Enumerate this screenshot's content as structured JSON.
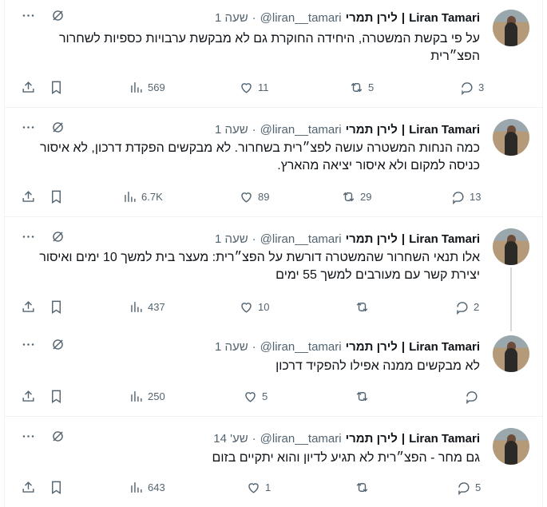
{
  "tweets": [
    {
      "name": "Liran Tamari",
      "hebrew_name": "לירן תמרי",
      "handle": "@liran__tamari",
      "time": "שעה 1",
      "text": "על פי בקשת המשטרה, היחידה החוקרת גם לא מבקשת ערבויות כספיות לשחרור הפצ״רית",
      "replies": "3",
      "reposts": "5",
      "likes": "11",
      "views": "569"
    },
    {
      "name": "Liran Tamari",
      "hebrew_name": "לירן תמרי",
      "handle": "@liran__tamari",
      "time": "שעה 1",
      "text": "כמה הנחות המשטרה עושה לפצ״רית בשחרור. לא מבקשים הפקדת דרכון, לא איסור כניסה למקום ולא איסור יציאה מהארץ.",
      "replies": "13",
      "reposts": "29",
      "likes": "89",
      "views": "6.7K"
    },
    {
      "name": "Liran Tamari",
      "hebrew_name": "לירן תמרי",
      "handle": "@liran__tamari",
      "time": "שעה 1",
      "text": "אלו תנאי השחרור שהמשטרה דורשת על הפצ״רית: מעצר בית למשך 10 ימים ואיסור יצירת קשר עם מעורבים למשך 55 ימים",
      "replies": "2",
      "reposts": "",
      "likes": "10",
      "views": "437"
    },
    {
      "name": "Liran Tamari",
      "hebrew_name": "לירן תמרי",
      "handle": "@liran__tamari",
      "time": "שעה 1",
      "text": "לא מבקשים ממנה אפילו להפקיד דרכון",
      "replies": "",
      "reposts": "",
      "likes": "5",
      "views": "250"
    },
    {
      "name": "Liran Tamari",
      "hebrew_name": "לירן תמרי",
      "handle": "@liran__tamari",
      "time": "שע' 14",
      "text": "גם מחר - הפצ״רית לא תגיע לדיון והוא יתקיים בזום",
      "replies": "5",
      "reposts": "",
      "likes": "1",
      "views": "643"
    }
  ],
  "separators": {
    "dot": "·",
    "bar": "|"
  },
  "icons": [
    "more-icon",
    "grok-icon",
    "share-icon",
    "bookmark-icon",
    "views-icon",
    "like-icon",
    "repost-icon",
    "reply-icon"
  ]
}
